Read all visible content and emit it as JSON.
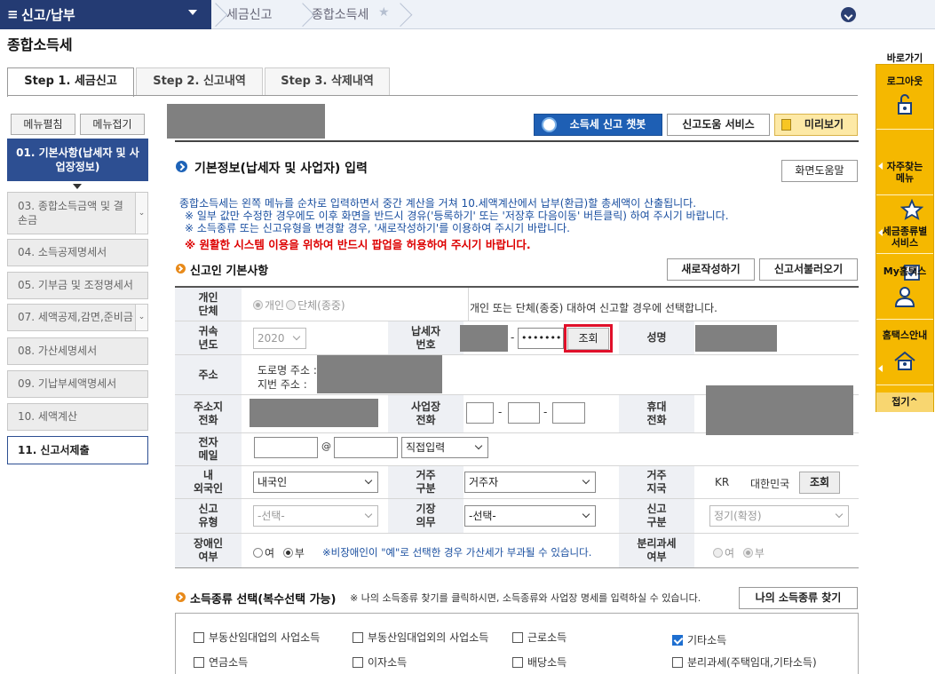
{
  "topbar": {
    "menu_title": "신고/납부",
    "crumbs": [
      "세금신고",
      "종합소득세"
    ]
  },
  "page_title": "종합소득세",
  "tabs": [
    "Step 1. 세금신고",
    "Step 2. 신고내역",
    "Step 3. 삭제내역"
  ],
  "left_menu": {
    "expand": "메뉴펼침",
    "collapse": "메뉴접기",
    "items": [
      "01. 기본사항(납세자 및 사업장정보)",
      "03. 종합소득금액 및 결손금",
      "04. 소득공제명세서",
      "05. 기부금 및 조정명세서",
      "07. 세액공제,감면,준비금",
      "08. 가산세명세서",
      "09. 기납부세액명세서",
      "10. 세액계산",
      "11. 신고서제출"
    ]
  },
  "toolbar": {
    "chatbot": "소득세 신고 챗봇",
    "help_service": "신고도움 서비스",
    "preview": "미리보기"
  },
  "section1": {
    "title": "기본정보(납세자 및 사업자) 입력",
    "screen_help": "화면도움말",
    "info1": "종합소득세는 왼쪽 메뉴를 순차로 입력하면서 중간 계산을 거쳐 10.세액계산에서 납부(환급)할 총세액이 산출됩니다.",
    "info2": "※ 일부 값만 수정한 경우에도 이후 화면을 반드시 경유('등록하기' 또는 '저장후 다음이동' 버튼클릭) 하여 주시기 바랍니다.",
    "info3": "※ 소득종류 또는 신고유형을 변경할 경우, '새로작성하기'를 이용하여 주시기 바랍니다.",
    "warning": "※ 원활한 시스템 이용을 위하여 반드시 팝업을 허용하여 주시기 바랍니다."
  },
  "basic": {
    "title": "신고인 기본사항",
    "new_btn": "새로작성하기",
    "load_btn": "신고서불러오기",
    "labels": {
      "indiv": "개인\n단체",
      "year": "귀속\n년도",
      "taxid": "납세자\n번호",
      "name": "성명",
      "addr": "주소",
      "homephone": "주소지\n전화",
      "bizphone": "사업장\n전화",
      "mobile": "휴대\n전화",
      "email": "전자\n메일",
      "foreign": "내\n외국인",
      "resident": "거주\n구분",
      "country": "거주\n지국",
      "rtype": "신고\n유형",
      "bookkeep": "기장\n의무",
      "rclass": "신고\n구분",
      "disabled": "장애인\n여부",
      "separate": "분리과세\n여부"
    },
    "indiv_opt1": "개인",
    "indiv_opt2": "단체(종중)",
    "indiv_note": "개인 또는 단체(종중) 대하여 신고할 경우에 선택합니다.",
    "year_value": "2020",
    "taxid_mask": "•••••••",
    "lookup": "조회",
    "road_addr": "도로명 주소 :",
    "lot_addr": "지번 주소 :",
    "at": "@",
    "email_domain": "직접입력",
    "foreign_value": "내국인",
    "resident_value": "거주자",
    "country_code": "KR",
    "country_name": "대한민국",
    "rtype_value": "-선택-",
    "bookkeep_value": "-선택-",
    "rclass_value": "정기(확정)",
    "yes": "여",
    "no": "부",
    "disabled_note": "※비장애인이 \"예\"로 선택한 경우 가산세가 부과될 수 있습니다."
  },
  "income": {
    "title": "소득종류 선택(복수선택 가능)",
    "note": "※ 나의 소득종류 찾기를 클릭하시면, 소득종류와 사업장 명세를 입력하실 수 있습니다.",
    "find_btn": "나의 소득종류 찾기",
    "options": [
      "부동산임대업의 사업소득",
      "부동산임대업외의 사업소득",
      "근로소득",
      "기타소득",
      "연금소득",
      "이자소득",
      "배당소득",
      "분리과세(주택임대,기타소득)"
    ],
    "checked": [
      false,
      false,
      false,
      true,
      false,
      false,
      false,
      false
    ]
  },
  "sidebar": {
    "title": "바로가기",
    "items": [
      "로그아웃",
      "자주찾는\n메뉴",
      "세금종류별\n서비스",
      "My홈택스",
      "홈택스안내"
    ],
    "fold": "접기^"
  }
}
